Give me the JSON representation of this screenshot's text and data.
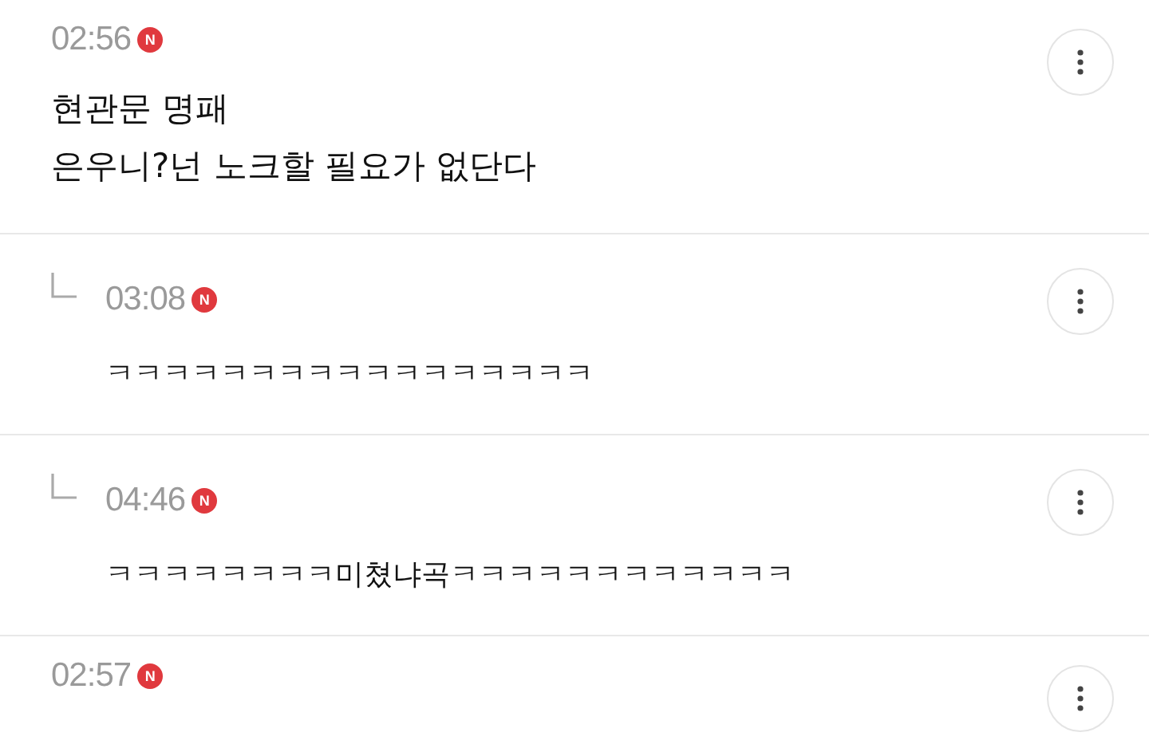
{
  "comments": [
    {
      "kind": "comment",
      "time": "02:56",
      "badge": "N",
      "text": "현관문 명패\n은우니?넌 노크할 필요가 없단다"
    },
    {
      "kind": "reply",
      "time": "03:08",
      "badge": "N",
      "text": "ㅋㅋㅋㅋㅋㅋㅋㅋㅋㅋㅋㅋㅋㅋㅋㅋㅋ"
    },
    {
      "kind": "reply",
      "time": "04:46",
      "badge": "N",
      "text": "ㅋㅋㅋㅋㅋㅋㅋㅋ미쳤냐곡ㅋㅋㅋㅋㅋㅋㅋㅋㅋㅋㅋㅋ"
    },
    {
      "kind": "comment",
      "time": "02:57",
      "badge": "N"
    }
  ]
}
